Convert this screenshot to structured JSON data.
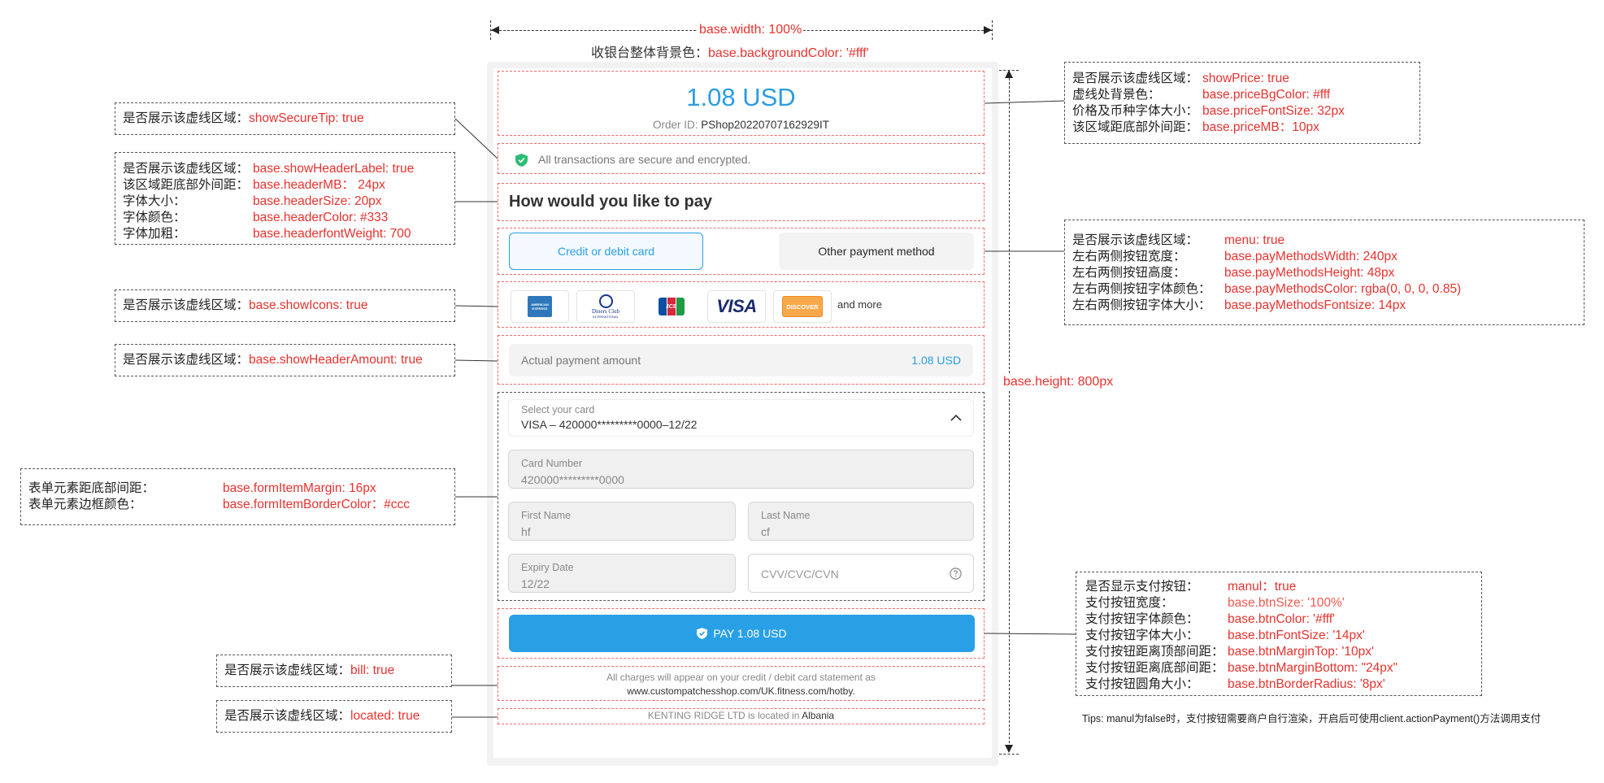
{
  "top": {
    "width_label": "base.width: 100%",
    "bg_key": "收银台整体背景色：",
    "bg_value": "base.backgroundColor: '#fff'"
  },
  "height_label": "base.height: 800px",
  "checkout": {
    "price": "1.08 USD",
    "order_label": "Order ID: ",
    "order_id": "PShop20220707162929IT",
    "secure_tip": "All transactions are secure and encrypted.",
    "header_label": "How would you like to pay",
    "pay_methods": [
      "Credit or debit card",
      "Other payment method"
    ],
    "card_logos": [
      "amex-logo",
      "diners-club-logo",
      "jcb-logo",
      "visa-logo",
      "discover-logo"
    ],
    "logo_texts": {
      "amex": "AMERICAN EXPRESS",
      "diners": "Diners Club",
      "diners_sub": "INTERNATIONAL",
      "jcb": "JCB",
      "visa": "VISA",
      "discover": "DISCOVER"
    },
    "and_more": "and more",
    "actual_amount_label": "Actual payment amount",
    "actual_amount_value": "1.08 USD",
    "select_card_label": "Select your card",
    "select_card_value": "VISA – 420000*********0000–12/22",
    "card_number_label": "Card Number",
    "card_number_value": "420000*********0000",
    "first_name_label": "First Name",
    "first_name_value": "hf",
    "last_name_label": "Last Name",
    "last_name_value": "cf",
    "expiry_label": "Expiry Date",
    "expiry_value": "12/22",
    "cvv_placeholder": "CVV/CVC/CVN",
    "pay_button": "PAY 1.08 USD",
    "bill_line1": "All charges will appear on your credit / debit card statement as",
    "bill_line2": "www.custompatchesshop.com/UK.fitness.com/hotby.",
    "located_prefix": "KENTING RIDGE LTD is located in ",
    "located_country": "Albania"
  },
  "colors": {
    "accent": "#29a0e6",
    "price": "#2b9de0",
    "annotation_red": "#e8322e",
    "secure_green": "#2dbd74"
  },
  "left_notes": {
    "secure_tip": {
      "k": "是否展示该虚线区域：",
      "v": "showSecureTip: true"
    },
    "header": [
      {
        "k": "是否展示该虚线区域：",
        "v": "base.showHeaderLabel: true"
      },
      {
        "k": "该区域距底部外间距：",
        "v": "base.headerMB： 24px"
      },
      {
        "k": "字体大小：",
        "v": "base.headerSize: 20px"
      },
      {
        "k": "字体颜色：",
        "v": "base.headerColor: #333"
      },
      {
        "k": "字体加粗：",
        "v": "base.headerfontWeight: 700"
      }
    ],
    "icons": {
      "k": "是否展示该虚线区域：",
      "v": "base.showIcons: true"
    },
    "amount": {
      "k": "是否展示该虚线区域：",
      "v": "base.showHeaderAmount: true"
    },
    "form": [
      {
        "k": "表单元素距底部间距：",
        "v": "base.formItemMargin: 16px"
      },
      {
        "k": "表单元素边框颜色：",
        "v": "base.formItemBorderColor：#ccc"
      }
    ],
    "bill": {
      "k": "是否展示该虚线区域：",
      "v": "bill: true"
    },
    "located": {
      "k": "是否展示该虚线区域：",
      "v": "located: true"
    }
  },
  "right_notes": {
    "price": [
      {
        "k": "是否展示该虚线区域：",
        "v": "showPrice: true"
      },
      {
        "k": "虚线处背景色：",
        "v": "base.priceBgColor: #fff"
      },
      {
        "k": "价格及币种字体大小：",
        "v": "base.priceFontSize: 32px"
      },
      {
        "k": "该区域距底部外间距：",
        "v": "base.priceMB：10px"
      }
    ],
    "menu": [
      {
        "k": "是否展示该虚线区域：",
        "v": "menu: true"
      },
      {
        "k": "左右两侧按钮宽度：",
        "v": "base.payMethodsWidth: 240px"
      },
      {
        "k": "左右两侧按钮高度：",
        "v": "base.payMethodsHeight: 48px"
      },
      {
        "k": "左右两侧按钮字体颜色：",
        "v": "base.payMethodsColor: rgba(0, 0, 0, 0.85)"
      },
      {
        "k": "左右两侧按钮字体大小：",
        "v": "base.payMethodsFontsize: 14px"
      }
    ],
    "button": [
      {
        "k": "是否显示支付按钮：",
        "v": "manul：true"
      },
      {
        "k": "支付按钮宽度：",
        "v": "base.btnSize: '100%'"
      },
      {
        "k": "支付按钮字体颜色：",
        "v": "base.btnColor: '#fff'"
      },
      {
        "k": "支付按钮字体大小：",
        "v": "base.btnFontSize: '14px'"
      },
      {
        "k": "支付按钮距离顶部间距：",
        "v": "base.btnMarginTop: '10px'"
      },
      {
        "k": "支付按钮距离底部间距：",
        "v": "base.btnMarginBottom: \"24px\""
      },
      {
        "k": "支付按钮圆角大小：",
        "v": "base.btnBorderRadius: '8px'"
      }
    ],
    "tips": "Tips: manul为false时，支付按钮需要商户自行渲染，开启后可使用client.actionPayment()方法调用支付"
  }
}
